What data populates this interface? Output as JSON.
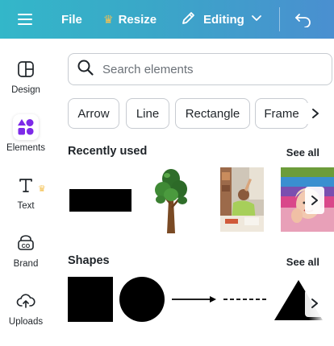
{
  "topbar": {
    "file_label": "File",
    "resize_label": "Resize",
    "editing_label": "Editing",
    "icons": [
      "menu-icon",
      "crown-icon",
      "pencil-icon",
      "chevron-down-icon",
      "undo-icon"
    ]
  },
  "sidebar": {
    "items": [
      {
        "label": "Design",
        "icon": "design-icon"
      },
      {
        "label": "Elements",
        "icon": "elements-icon",
        "active": true
      },
      {
        "label": "Text",
        "icon": "text-icon"
      },
      {
        "label": "Brand",
        "icon": "brand-icon"
      },
      {
        "label": "Uploads",
        "icon": "uploads-icon"
      }
    ]
  },
  "search": {
    "placeholder": "Search elements",
    "value": ""
  },
  "chips": [
    "Arrow",
    "Line",
    "Rectangle",
    "Frame"
  ],
  "recently_used": {
    "title": "Recently used",
    "see_all": "See all"
  },
  "shapes": {
    "title": "Shapes",
    "see_all": "See all"
  },
  "colors": {
    "accent_gradient_start": "#33b7c9",
    "accent_gradient_end": "#4a8fd0",
    "crown": "#f4c152",
    "elements_icon": "#7d2ae8"
  }
}
